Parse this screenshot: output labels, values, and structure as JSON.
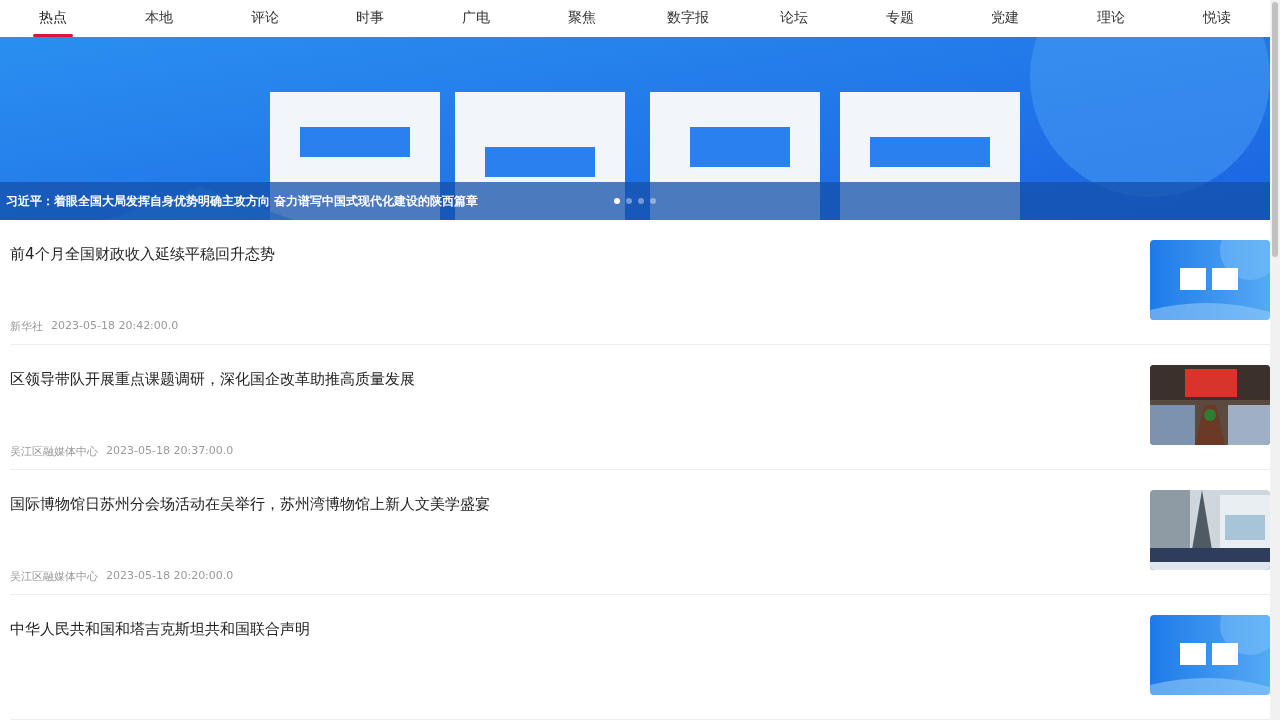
{
  "tabs": [
    {
      "label": "热点",
      "selected": true
    },
    {
      "label": "本地",
      "selected": false
    },
    {
      "label": "评论",
      "selected": false
    },
    {
      "label": "时事",
      "selected": false
    },
    {
      "label": "广电",
      "selected": false
    },
    {
      "label": "聚焦",
      "selected": false
    },
    {
      "label": "数字报",
      "selected": false
    },
    {
      "label": "论坛",
      "selected": false
    },
    {
      "label": "专题",
      "selected": false
    },
    {
      "label": "党建",
      "selected": false
    },
    {
      "label": "理论",
      "selected": false
    },
    {
      "label": "悦读",
      "selected": false
    }
  ],
  "banner": {
    "kind": "picture",
    "caption": "习近平：着眼全国大局发挥自身优势明确主攻方向 奋力谱写中国式现代化建设的陕西篇章",
    "dots": [
      {
        "selected": true
      },
      {
        "selected": false
      },
      {
        "selected": false
      },
      {
        "selected": false
      }
    ]
  },
  "news": [
    {
      "title": "前4个月全国财政收入延续平稳回升态势",
      "source": "新华社",
      "time": "2023-05-18 20:42:00.0"
    },
    {
      "title": "区领导带队开展重点课题调研，深化国企改革助推高质量发展",
      "source": "吴江区融媒体中心",
      "time": "2023-05-18 20:37:00.0"
    },
    {
      "title": "国际博物馆日苏州分会场活动在吴举行，苏州湾博物馆上新人文美学盛宴",
      "source": "吴江区融媒体中心",
      "time": "2023-05-18 20:20:00.0"
    },
    {
      "title": "中华人民共和国和塔吉克斯坦共和国联合声明"
    }
  ]
}
